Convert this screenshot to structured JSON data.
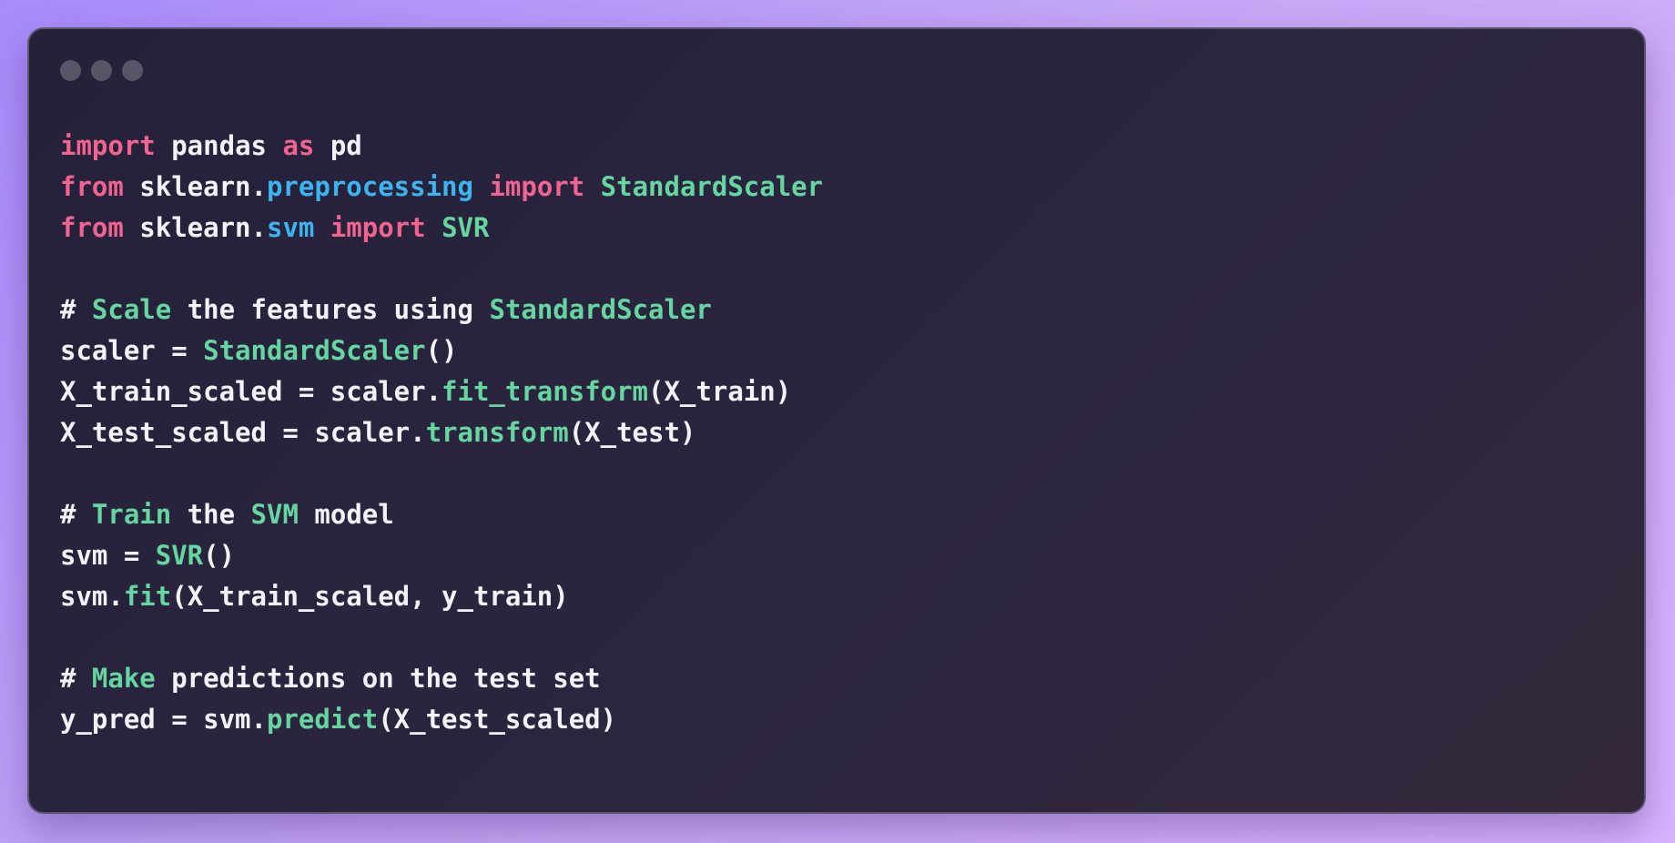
{
  "window": {
    "controls": [
      {
        "name": "close"
      },
      {
        "name": "minimize"
      },
      {
        "name": "maximize"
      }
    ]
  },
  "code": {
    "lines": [
      [
        [
          "keyword",
          "import"
        ],
        [
          "text",
          " pandas "
        ],
        [
          "keyword",
          "as"
        ],
        [
          "text",
          " pd"
        ]
      ],
      [
        [
          "keyword",
          "from"
        ],
        [
          "text",
          " sklearn."
        ],
        [
          "module",
          "preprocessing"
        ],
        [
          "text",
          " "
        ],
        [
          "keyword",
          "import"
        ],
        [
          "text",
          " "
        ],
        [
          "class",
          "StandardScaler"
        ]
      ],
      [
        [
          "keyword",
          "from"
        ],
        [
          "text",
          " sklearn."
        ],
        [
          "module",
          "svm"
        ],
        [
          "text",
          " "
        ],
        [
          "keyword",
          "import"
        ],
        [
          "text",
          " "
        ],
        [
          "class",
          "SVR"
        ]
      ],
      [],
      [
        [
          "comment",
          "# "
        ],
        [
          "highlight",
          "Scale"
        ],
        [
          "comment",
          " the features using "
        ],
        [
          "highlight",
          "StandardScaler"
        ]
      ],
      [
        [
          "text",
          "scaler = "
        ],
        [
          "class",
          "StandardScaler"
        ],
        [
          "text",
          "()"
        ]
      ],
      [
        [
          "text",
          "X_train_scaled = scaler."
        ],
        [
          "func",
          "fit_transform"
        ],
        [
          "text",
          "(X_train)"
        ]
      ],
      [
        [
          "text",
          "X_test_scaled = scaler."
        ],
        [
          "func",
          "transform"
        ],
        [
          "text",
          "(X_test)"
        ]
      ],
      [],
      [
        [
          "comment",
          "# "
        ],
        [
          "highlight",
          "Train"
        ],
        [
          "comment",
          " the "
        ],
        [
          "highlight",
          "SVM"
        ],
        [
          "comment",
          " model"
        ]
      ],
      [
        [
          "text",
          "svm = "
        ],
        [
          "class",
          "SVR"
        ],
        [
          "text",
          "()"
        ]
      ],
      [
        [
          "text",
          "svm."
        ],
        [
          "func",
          "fit"
        ],
        [
          "text",
          "(X_train_scaled, y_train)"
        ]
      ],
      [],
      [
        [
          "comment",
          "# "
        ],
        [
          "highlight",
          "Make"
        ],
        [
          "comment",
          " predictions on the test set"
        ]
      ],
      [
        [
          "text",
          "y_pred = svm."
        ],
        [
          "func",
          "predict"
        ],
        [
          "text",
          "(X_test_scaled)"
        ]
      ]
    ]
  }
}
